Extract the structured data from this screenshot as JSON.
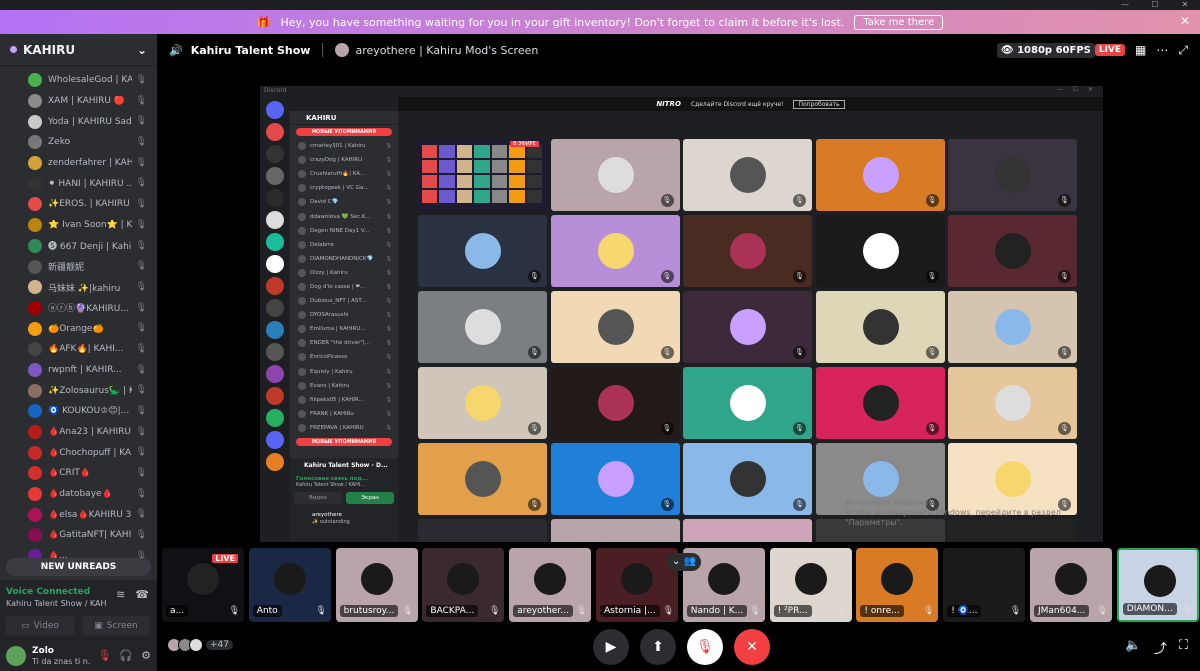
{
  "banner": {
    "text": "Hey, you have something waiting for you in your gift inventory! Don't forget to claim it before it's lost.",
    "button": "Take me there"
  },
  "server": {
    "name": "KAHIRU"
  },
  "members": [
    {
      "name": "WholesaleGod | KA...",
      "color": "#4caf50"
    },
    {
      "name": "XAM | KAHIRU 🔴",
      "color": "#8b8b8b"
    },
    {
      "name": "Yoda | KAHIRU Sad...",
      "color": "#c8c8c8"
    },
    {
      "name": "Zeko",
      "color": "#777777"
    },
    {
      "name": "zenderfahrer | KAHI...",
      "color": "#d4a23a"
    },
    {
      "name": "⚫ HANI | KAHIRU ...",
      "color": "#333333"
    },
    {
      "name": "✨EROS. | KAHIRU ...",
      "color": "#e34a4a"
    },
    {
      "name": "⭐ Ivan Soon⭐ | K...",
      "color": "#b8860b"
    },
    {
      "name": "🅢 667 Denji | Kahir...",
      "color": "#2e8b57"
    },
    {
      "name": "新疆靓妮",
      "color": "#555555"
    },
    {
      "name": "马妹妹 ✨|kahiru",
      "color": "#d2b48c"
    },
    {
      "name": "ⓐⓡⓑ🔮KAHIRU...",
      "color": "#a00000"
    },
    {
      "name": "🍊Orange🍊",
      "color": "#f39c12"
    },
    {
      "name": "🔥AFK🔥| KAHI...",
      "color": "#444444"
    },
    {
      "name": "rwpnft | KAHIR...",
      "color": "#7e57c2"
    },
    {
      "name": "✨Zolosaurus🦕 | K...",
      "color": "#8d6e63"
    },
    {
      "name": "🧿 KOUKOU♔😊|...",
      "color": "#1565c0"
    },
    {
      "name": "🩸Ana23 | KAHIRU ...",
      "color": "#b71c1c"
    },
    {
      "name": "🩸Chochopuff | KA...",
      "color": "#c62828"
    },
    {
      "name": "🩸CRIT🩸",
      "color": "#d32f2f"
    },
    {
      "name": "🩸datobaye🩸",
      "color": "#e53935"
    },
    {
      "name": "🩸elsa🩸KAHIRU 3 ...",
      "color": "#ad1457"
    },
    {
      "name": "🩸GatitaNFT| KAHI...",
      "color": "#880e4f"
    },
    {
      "name": "🩸...",
      "color": "#6a1b9a"
    }
  ],
  "new_unreads": "NEW UNREADS",
  "voice": {
    "status": "Voice Connected",
    "channel": "Kahiru Talent Show / KAH...",
    "video_label": "Video",
    "screen_label": "Screen"
  },
  "user": {
    "name": "Zolo",
    "status": "Ti da znas ti n..."
  },
  "header": {
    "channel": "Kahiru Talent Show",
    "stream": "areyothere | Kahiru Mod's Screen",
    "quality": "1080p 60FPS",
    "live": "LIVE"
  },
  "inner": {
    "app": "Discord",
    "nitro_brand": "NITRO",
    "nitro_text": "Сделайте Discord ещё круче!",
    "nitro_button": "Попробовать",
    "server": "KAHIRU",
    "new_mentions": "НОВЫЕ УПОМИНАНИЯ",
    "members": [
      "cmarley301 | Kahiru",
      "crazyDog | KAHIRU",
      "CrushieruHi🔥| KA...",
      "cryptogeek | VC Ga...",
      "David C💎",
      "ddawnlova 💚 Sec.K...",
      "Degen NINE Day1 V...",
      "Delabrre",
      "DIAMONDHANDNICK💎",
      "Dizzy | Kahiru",
      "Dog d'lo casse | ❤...",
      "Dubious_NFT | AST...",
      "DYOSArasushi",
      "Emiluma | KAHIRU...",
      "ENDER \"the driver\"|...",
      "EnricoPicasso",
      "Equisly | Kahiru",
      "Evans | Kahiru",
      "filipeks05 | KAHIR...",
      "FRANK | KAHIRu",
      "FREEPAVA | KAHIRU"
    ],
    "channel_bottom": "Kahiru Talent Show - D...",
    "voice_status": "Голосовая связь под...",
    "voice_channel": "Kahiru Talent Show / KAHI...",
    "video": "Видео",
    "screen": "Экран",
    "user": "areyothere",
    "user_status": "✨ outstanding",
    "live_tag": "В ЭФИРЕ",
    "watermark_title": "Активация Windows",
    "watermark_text": "Чтобы активировать Windows, перейдите в раздел \"Параметры\"."
  },
  "tiles_colors": [
    "#1f1b2e",
    "#b9a4aa",
    "#dcd6ce",
    "#d97b25",
    "#3a3440",
    "#2a3140",
    "#b78fd9",
    "#4a2b22",
    "#1a1a1a",
    "#5a2830",
    "#7c7f82",
    "#f2d9b5",
    "#3c2a3b",
    "#ddd7b8",
    "#d5c4b0",
    "#cfc5b8",
    "#221a18",
    "#2fa68a",
    "#d8245d",
    "#e5c79b",
    "#e2a04a",
    "#1f7fd9",
    "#8ab8e8",
    "#8a8a8a",
    "#f6e1c3"
  ],
  "thumbnails": [
    {
      "label": "a...",
      "color": "#101015",
      "live": "LIVE"
    },
    {
      "label": "Anto",
      "color": "#1b2845"
    },
    {
      "label": "brutusroy...",
      "color": "#b9a4aa"
    },
    {
      "label": "BACKPA...",
      "color": "#3a2a2e"
    },
    {
      "label": "areyother...",
      "color": "#b9a4aa"
    },
    {
      "label": "Astornia |...",
      "color": "#4a1f24"
    },
    {
      "label": "Nando | K...",
      "color": "#b9a4aa"
    },
    {
      "label": "! ²PR...",
      "color": "#dcd6ce"
    },
    {
      "label": "! onre...",
      "color": "#d97b25"
    },
    {
      "label": "! 🧿...",
      "color": "#1a1a1a"
    },
    {
      "label": "JMan604...",
      "color": "#b9a4aa"
    },
    {
      "label": "DIAMON...",
      "color": "#c9d3e6"
    }
  ],
  "participants_extra": "+47"
}
